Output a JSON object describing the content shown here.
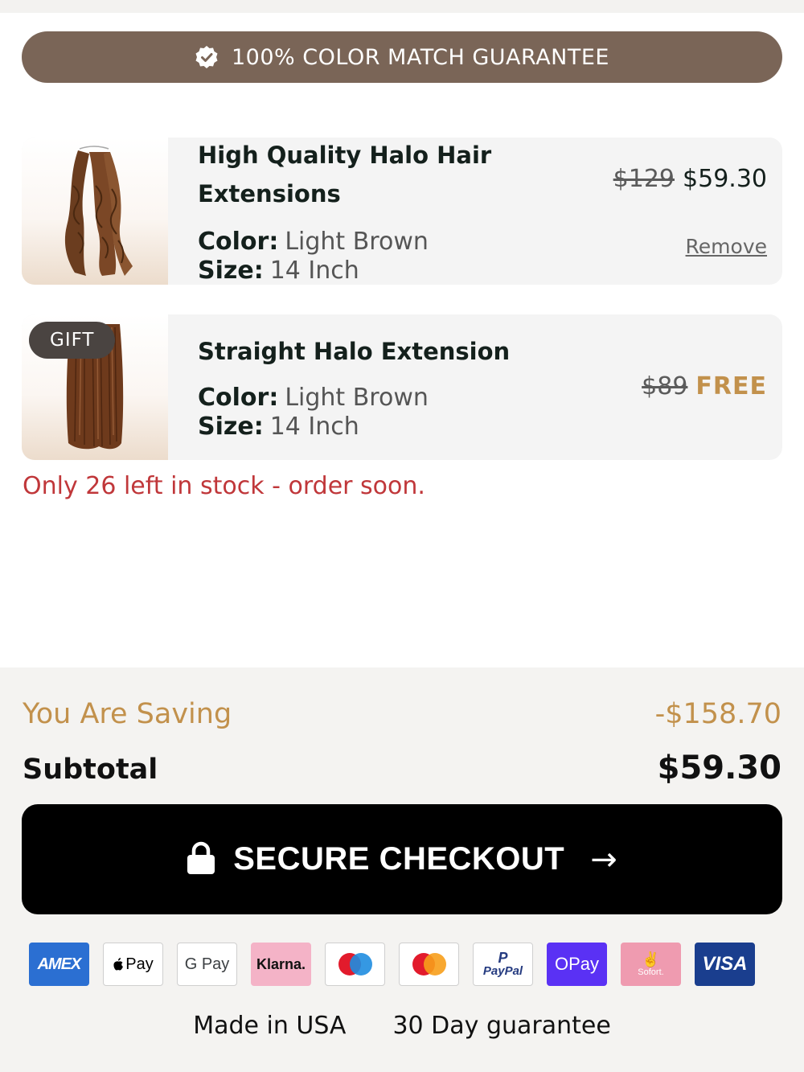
{
  "banner": {
    "text": "100% COLOR MATCH GUARANTEE",
    "icon": "verified-badge-icon"
  },
  "cart_items": [
    {
      "title": "High Quality Halo Hair Extensions",
      "color_label": "Color:",
      "color_value": "Light Brown",
      "size_label": "Size:",
      "size_value": "14 Inch",
      "old_price": "$129",
      "new_price": "$59.30",
      "remove_label": "Remove"
    },
    {
      "tag": "GIFT",
      "title": "Straight Halo Extension",
      "color_label": "Color:",
      "color_value": "Light Brown",
      "size_label": "Size:",
      "size_value": "14 Inch",
      "old_price": "$89",
      "new_price": "FREE"
    }
  ],
  "stock_message": "Only 26 left in stock - order soon.",
  "summary": {
    "saving_label": "You Are Saving",
    "saving_value": "-$158.70",
    "subtotal_label": "Subtotal",
    "subtotal_value": "$59.30"
  },
  "checkout": {
    "label": "SECURE CHECKOUT",
    "arrow": "→"
  },
  "payment_methods": [
    {
      "label": "AMEX"
    },
    {
      "label": "Pay"
    },
    {
      "label": "G Pay"
    },
    {
      "label": "Klarna."
    },
    {
      "label": "Maestro"
    },
    {
      "label": "Mastercard"
    },
    {
      "label": "PayPal"
    },
    {
      "label": "OPay"
    },
    {
      "label": "Sofort."
    },
    {
      "label": "VISA"
    }
  ],
  "footer": {
    "made_in": "Made in USA",
    "guarantee": "30 Day guarantee"
  },
  "colors": {
    "banner": "#7a6557",
    "accent_gold": "#c2914c",
    "stock_red": "#c0373a",
    "checkout_bg": "#000000"
  }
}
